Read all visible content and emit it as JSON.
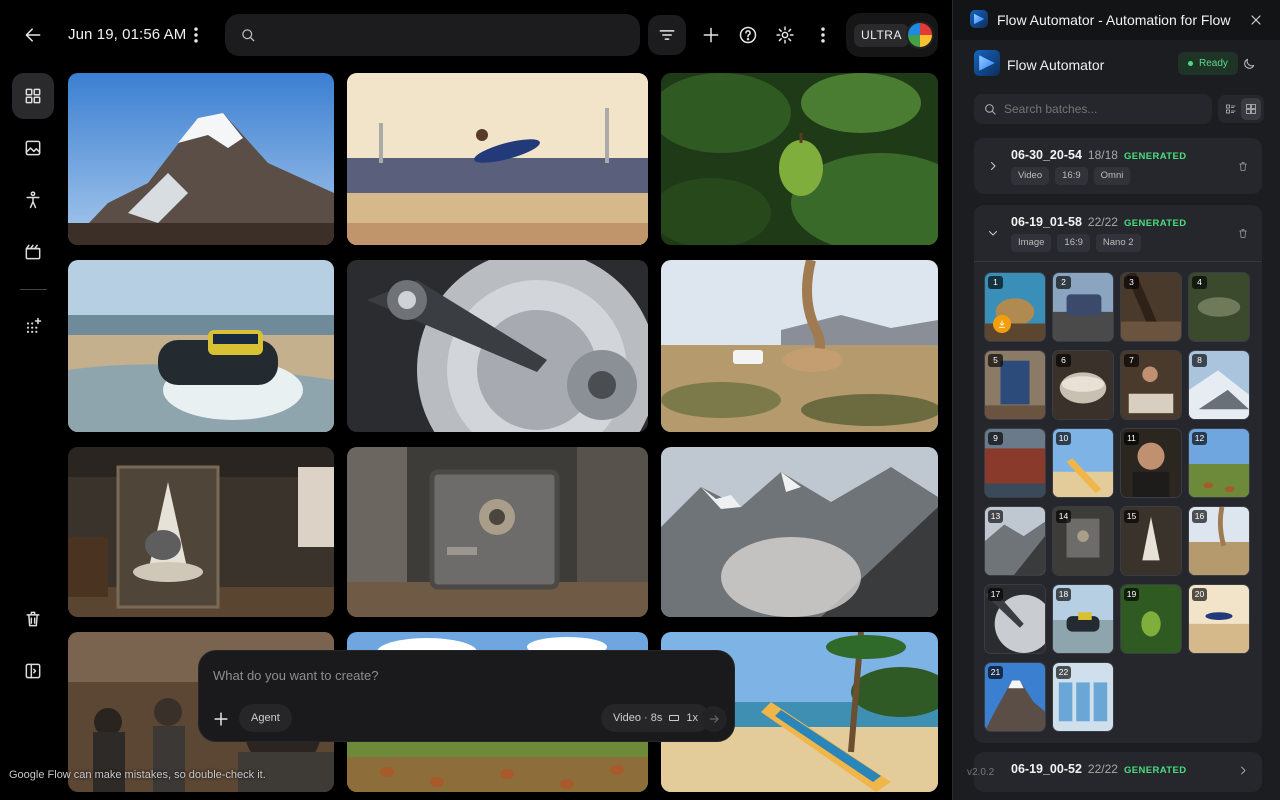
{
  "app": {
    "date_label": "Jun 19, 01:56 AM",
    "search_placeholder": "",
    "plan_badge": "ULTRA",
    "prompt": {
      "placeholder": "What do you want to create?",
      "agent_label": "Agent",
      "mode_label": "Video · 8s",
      "count_label": "1x"
    },
    "disclaimer": "Google Flow can make mistakes, so double-check it.",
    "grid_images": [
      {
        "subject": "snowy-mountain-peak"
      },
      {
        "subject": "long-jump-athlete"
      },
      {
        "subject": "green-fruit-in-jungle"
      },
      {
        "subject": "hovercraft-on-beach"
      },
      {
        "subject": "hard-drive-platter"
      },
      {
        "subject": "desert-dust-devil-truck"
      },
      {
        "subject": "museum-cone-exhibit"
      },
      {
        "subject": "metal-safe-workshop"
      },
      {
        "subject": "mountain-rockslide"
      },
      {
        "subject": "cafe-crowd"
      },
      {
        "subject": "chickens-in-field"
      },
      {
        "subject": "surfboard-palm-beach"
      }
    ]
  },
  "panel": {
    "window_title": "Flow Automator - Automation for Flow",
    "brand_name": "Flow Automator",
    "status_label": "Ready",
    "search_placeholder": "Search batches...",
    "version": "v2.0.2",
    "batches": [
      {
        "name": "06-30_20-54",
        "count": "18/18",
        "status": "GENERATED",
        "tags": [
          "Video",
          "16:9",
          "Omni"
        ],
        "expanded": false
      },
      {
        "name": "06-19_01-58",
        "count": "22/22",
        "status": "GENERATED",
        "tags": [
          "Image",
          "16:9",
          "Nano 2"
        ],
        "expanded": true
      },
      {
        "name": "06-19_00-52",
        "count": "22/22",
        "status": "GENERATED",
        "tags": [],
        "expanded": false
      }
    ],
    "thumb_numbers": [
      "1",
      "2",
      "3",
      "4",
      "5",
      "6",
      "7",
      "8",
      "9",
      "10",
      "11",
      "12",
      "13",
      "14",
      "15",
      "16",
      "17",
      "18",
      "19",
      "20",
      "21",
      "22"
    ]
  },
  "colors": {
    "accent_green": "#4ade80",
    "download_badge": "#f59e0b"
  }
}
